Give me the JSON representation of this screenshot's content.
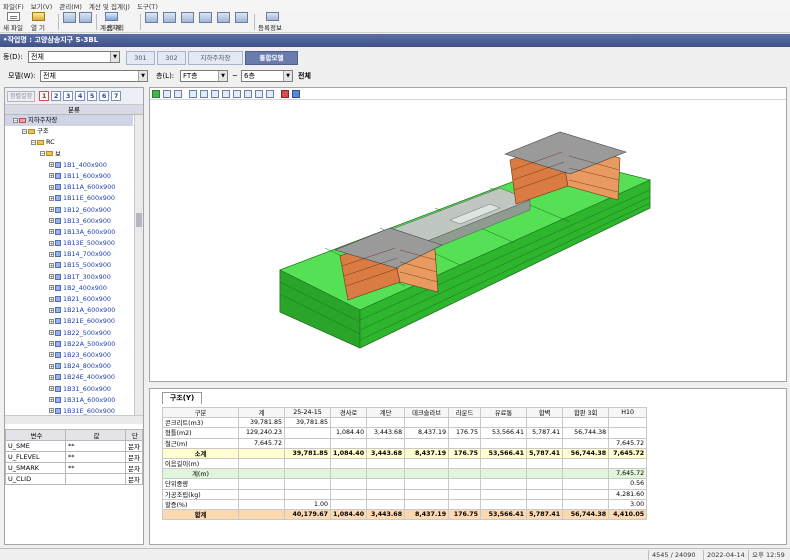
{
  "menu": [
    "파일(F)",
    "보기(V)",
    "관리(M)",
    "계산 및 집계(J)",
    "도구(T)"
  ],
  "toolbar": {
    "new": "새 파일",
    "open": "열 기",
    "calc": "계산처리",
    "sum": "집 계",
    "register": "등록정보"
  },
  "title": "•작업명 : 고양삼송지구 S-3BL",
  "building": {
    "label": "동(D):",
    "value": "전체"
  },
  "tabs": [
    "301",
    "302",
    "지하주차장",
    "통합모델"
  ],
  "active_tab": 3,
  "model": {
    "label": "모델(W):",
    "value": "전체"
  },
  "floor": {
    "label": "층(L):",
    "from": "FT층",
    "tilde": "~",
    "to": "6층",
    "all": "전체"
  },
  "left_panel": {
    "sort_btn": "정렬설정",
    "numbers": [
      "1",
      "2",
      "3",
      "4",
      "5",
      "6",
      "7"
    ],
    "tree_header": "분류",
    "tree": [
      {
        "label": "지하주차장",
        "level": 0,
        "kind": "folder"
      },
      {
        "label": "구조",
        "level": 1,
        "kind": "folder"
      },
      {
        "label": "RC",
        "level": 2,
        "kind": "folder"
      },
      {
        "label": "보",
        "level": 3,
        "kind": "folder"
      },
      {
        "label": "1B1_400x900",
        "level": 4,
        "kind": "beam"
      },
      {
        "label": "1B11_600x900",
        "level": 4,
        "kind": "beam"
      },
      {
        "label": "1B11A_600x900",
        "level": 4,
        "kind": "beam"
      },
      {
        "label": "1B11E_600x900",
        "level": 4,
        "kind": "beam"
      },
      {
        "label": "1B12_600x900",
        "level": 4,
        "kind": "beam"
      },
      {
        "label": "1B13_600x900",
        "level": 4,
        "kind": "beam"
      },
      {
        "label": "1B13A_600x900",
        "level": 4,
        "kind": "beam"
      },
      {
        "label": "1B13E_500x900",
        "level": 4,
        "kind": "beam"
      },
      {
        "label": "1B14_700x900",
        "level": 4,
        "kind": "beam"
      },
      {
        "label": "1B15_500x900",
        "level": 4,
        "kind": "beam"
      },
      {
        "label": "1B1T_300x900",
        "level": 4,
        "kind": "beam"
      },
      {
        "label": "1B2_400x900",
        "level": 4,
        "kind": "beam"
      },
      {
        "label": "1B21_600x900",
        "level": 4,
        "kind": "beam"
      },
      {
        "label": "1B21A_600x900",
        "level": 4,
        "kind": "beam"
      },
      {
        "label": "1B21E_600x900",
        "level": 4,
        "kind": "beam"
      },
      {
        "label": "1B22_500x900",
        "level": 4,
        "kind": "beam"
      },
      {
        "label": "1B22A_500x900",
        "level": 4,
        "kind": "beam"
      },
      {
        "label": "1B23_600x900",
        "level": 4,
        "kind": "beam"
      },
      {
        "label": "1B24_800x900",
        "level": 4,
        "kind": "beam"
      },
      {
        "label": "1B24E_400x900",
        "level": 4,
        "kind": "beam"
      },
      {
        "label": "1B31_600x900",
        "level": 4,
        "kind": "beam"
      },
      {
        "label": "1B31A_600x900",
        "level": 4,
        "kind": "beam"
      },
      {
        "label": "1B31E_600x900",
        "level": 4,
        "kind": "beam"
      }
    ],
    "prop_headers": [
      "변수",
      "값",
      "단"
    ],
    "props": [
      [
        "U_SME",
        "**",
        "문자"
      ],
      [
        "U_FLEVEL",
        "**",
        "문자"
      ],
      [
        "U_SMARK",
        "**",
        "문자"
      ],
      [
        "U_CLID",
        "",
        "문자"
      ]
    ]
  },
  "bottom": {
    "tab": "구조(Y)",
    "headers": [
      "구분",
      "계",
      "25-24-15",
      "경사로",
      "계단",
      "데크슬라브",
      "라운드",
      "유료통",
      "합벽",
      "합판 3회",
      "H10"
    ],
    "rows": [
      {
        "cls": "",
        "cells": [
          "콘크리트(m3)",
          "39,781.85",
          "39,781.85",
          "",
          "",
          "",
          "",
          "",
          "",
          "",
          ""
        ]
      },
      {
        "cls": "",
        "cells": [
          "형틀(m2)",
          "129,240.23",
          "",
          "1,084.40",
          "3,443.68",
          "8,437.19",
          "176.75",
          "53,566.41",
          "5,787.41",
          "56,744.38",
          ""
        ]
      },
      {
        "cls": "",
        "cells": [
          "철근(m)",
          "7,645.72",
          "",
          "",
          "",
          "",
          "",
          "",
          "",
          "",
          "7,645.72"
        ]
      },
      {
        "cls": "sub",
        "cells": [
          "소계",
          "",
          "39,781.85",
          "1,084.40",
          "3,443.68",
          "8,437.19",
          "176.75",
          "53,566.41",
          "5,787.41",
          "56,744.38",
          "7,645.72"
        ]
      },
      {
        "cls": "",
        "cells": [
          "이음길이(m)",
          "",
          "",
          "",
          "",
          "",
          "",
          "",
          "",
          "",
          ""
        ]
      },
      {
        "cls": "len",
        "cells": [
          "계(m)",
          "",
          "",
          "",
          "",
          "",
          "",
          "",
          "",
          "",
          "7,645.72"
        ]
      },
      {
        "cls": "",
        "cells": [
          "단위중량",
          "",
          "",
          "",
          "",
          "",
          "",
          "",
          "",
          "",
          "0.56"
        ]
      },
      {
        "cls": "",
        "cells": [
          "가공조립(kg)",
          "",
          "",
          "",
          "",
          "",
          "",
          "",
          "",
          "",
          "4,281.60"
        ]
      },
      {
        "cls": "",
        "cells": [
          "할증(%)",
          "",
          "1.00",
          "",
          "",
          "",
          "",
          "",
          "",
          "",
          "3.00"
        ]
      },
      {
        "cls": "tot",
        "cells": [
          "합계",
          "",
          "40,179.67",
          "1,084.40",
          "3,443.68",
          "8,437.19",
          "176.75",
          "53,566.41",
          "5,787.41",
          "56,744.38",
          "4,410.05"
        ]
      }
    ]
  },
  "status": {
    "count": "4545 / 24090",
    "date": "2022-04-14",
    "time": "오후 12:59"
  },
  "colors": {
    "slab": "#3fd13f",
    "wall": "#d97b42",
    "roof": "#9a9a9a",
    "title": "#3f5187"
  }
}
